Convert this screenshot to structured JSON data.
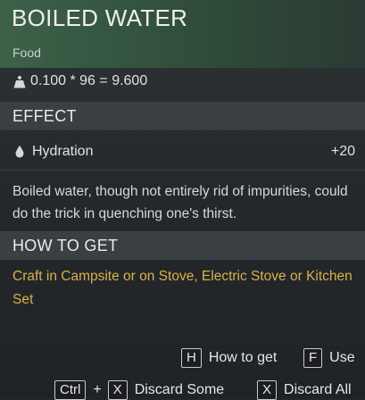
{
  "item": {
    "title": "BOILED WATER",
    "category": "Food",
    "weight_formula": "0.100 * 96 = 9.600",
    "weight_icon": "weight-icon"
  },
  "effect": {
    "header": "EFFECT",
    "stat_icon": "water-drop-icon",
    "stat_name": "Hydration",
    "stat_value": "+20",
    "description": "Boiled water, though not entirely rid of impurities, could do the trick in quenching one's thirst."
  },
  "how_to_get": {
    "header": "HOW TO GET",
    "text": "Craft in Campsite or on Stove, Electric Stove or Kitchen Set"
  },
  "hints": {
    "how_to_get_key": "H",
    "how_to_get_label": "How to get",
    "use_key": "F",
    "use_label": "Use",
    "ctrl_key": "Ctrl",
    "plus": "+",
    "discard_some_key": "X",
    "discard_some_label": "Discard Some",
    "discard_all_key": "X",
    "discard_all_label": "Discard All"
  },
  "colors": {
    "header_green": "#3d6149",
    "how_to_get_text": "#d9b04e"
  }
}
